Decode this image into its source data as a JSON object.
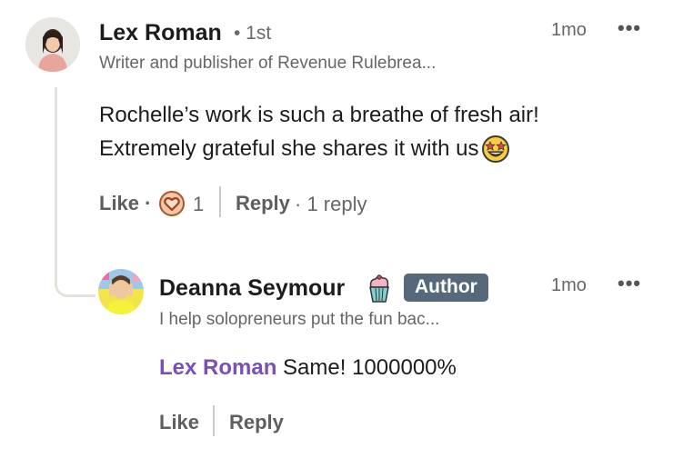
{
  "comment": {
    "author": "Lex Roman",
    "degree": "• 1st",
    "headline": "Writer and publisher of Revenue Rulebrea...",
    "time": "1mo",
    "more": "•••",
    "text_line1": "Rochelle’s work is such a breathe of fresh air!",
    "text_line2": "Extremely grateful she shares it with us",
    "emoji": "star-struck-emoji",
    "like_label": "Like ·",
    "reaction_icon": "heart-reaction-icon",
    "reaction_count": "1",
    "reply_label": "Reply",
    "reply_count": "· 1 reply"
  },
  "reply": {
    "author": "Deanna Seymour",
    "author_icon": "cupcake-icon",
    "badge": "Author",
    "headline": "I help solopreneurs put the fun bac...",
    "time": "1mo",
    "more": "•••",
    "mention": "Lex Roman",
    "text": " Same! 1000000%",
    "like_label": "Like",
    "reply_label": "Reply"
  },
  "colors": {
    "mention": "#7b4fb8",
    "badge_bg": "#56687a",
    "thread_line": "#e4e1dc"
  }
}
